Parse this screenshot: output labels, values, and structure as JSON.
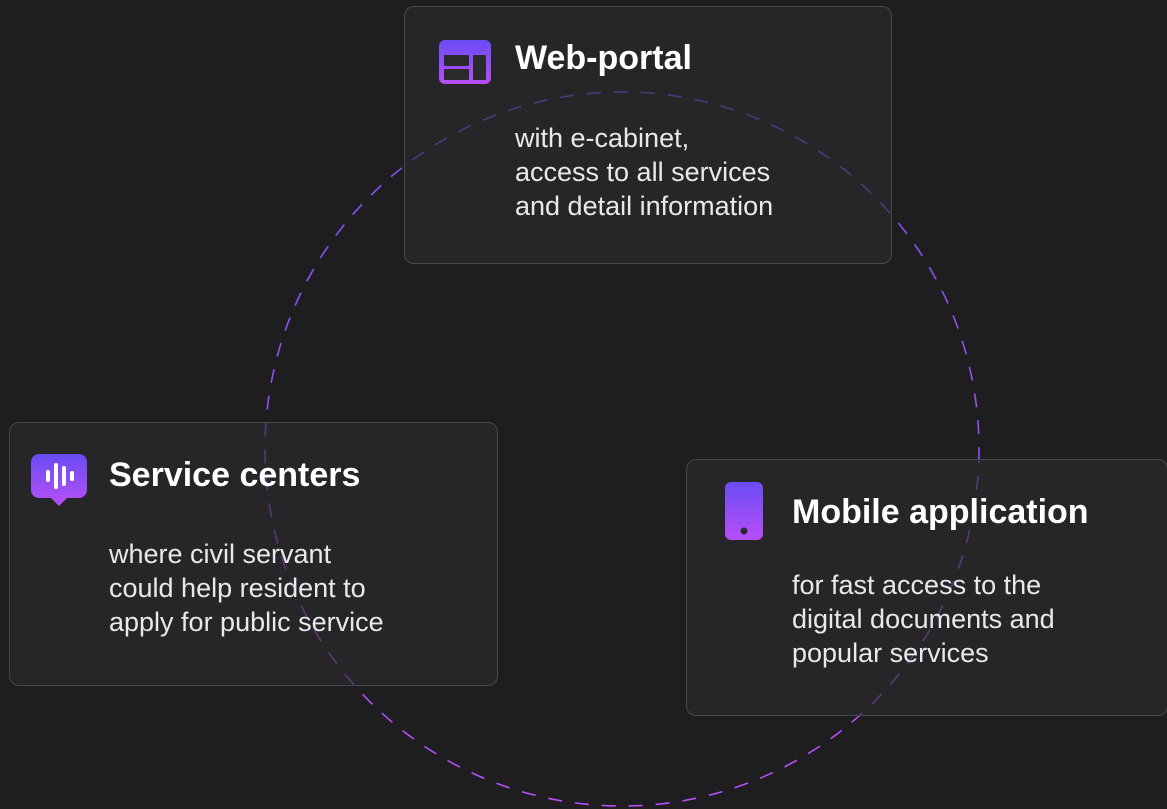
{
  "colors": {
    "background": "#1e1e20",
    "accent_start": "#b84ef6",
    "accent_end": "#6a4cf4",
    "ring": "#8e50f0"
  },
  "cards": {
    "web_portal": {
      "icon": "browser-window-icon",
      "title": "Web-portal",
      "description": "with e-cabinet,\naccess to all services\nand detail information"
    },
    "service_centers": {
      "icon": "chat-bubble-audio-icon",
      "title": "Service centers",
      "description": "where civil servant\ncould help resident to\napply for public service"
    },
    "mobile_app": {
      "icon": "smartphone-icon",
      "title": "Mobile application",
      "description": "for fast access to the\ndigital documents and\npopular services"
    }
  }
}
